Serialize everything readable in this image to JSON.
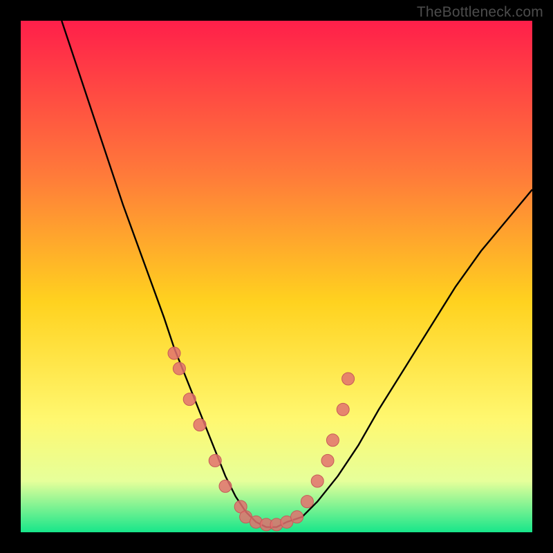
{
  "watermark": "TheBottleneck.com",
  "colors": {
    "frame": "#000000",
    "grad_top": "#ff1f4a",
    "grad_upper": "#ff7a3a",
    "grad_mid": "#ffd21f",
    "grad_lower": "#fff870",
    "grad_band": "#e6ff9a",
    "grad_bottom": "#17e68a",
    "curve": "#000000",
    "dot_fill": "#e2716f",
    "dot_stroke": "#c55a58"
  },
  "chart_data": {
    "type": "line",
    "title": "",
    "xlabel": "",
    "ylabel": "",
    "xlim": [
      0,
      100
    ],
    "ylim": [
      0,
      100
    ],
    "axes_visible": false,
    "grid": false,
    "legend": false,
    "series": [
      {
        "name": "bottleneck-curve",
        "x": [
          8,
          12,
          16,
          20,
          24,
          28,
          30,
          32,
          34,
          36,
          38,
          40,
          42,
          44,
          46,
          48,
          50,
          52,
          55,
          58,
          62,
          66,
          70,
          75,
          80,
          85,
          90,
          95,
          100
        ],
        "y": [
          100,
          88,
          76,
          64,
          53,
          42,
          36,
          31,
          26,
          21,
          16,
          11,
          7,
          4,
          2,
          1,
          1,
          2,
          3,
          6,
          11,
          17,
          24,
          32,
          40,
          48,
          55,
          61,
          67
        ]
      }
    ],
    "markers": [
      {
        "name": "left-cluster",
        "x": [
          30,
          31,
          33,
          35,
          38,
          40,
          43
        ],
        "y": [
          35,
          32,
          26,
          21,
          14,
          9,
          5
        ]
      },
      {
        "name": "valley-cluster",
        "x": [
          44,
          46,
          48,
          50,
          52,
          54
        ],
        "y": [
          3,
          2,
          1.5,
          1.5,
          2,
          3
        ]
      },
      {
        "name": "right-cluster",
        "x": [
          56,
          58,
          60,
          61,
          63,
          64
        ],
        "y": [
          6,
          10,
          14,
          18,
          24,
          30
        ]
      }
    ],
    "background_gradient_stops": [
      {
        "pos": 0.0,
        "color": "#ff1f4a"
      },
      {
        "pos": 0.3,
        "color": "#ff7a3a"
      },
      {
        "pos": 0.55,
        "color": "#ffd21f"
      },
      {
        "pos": 0.78,
        "color": "#fff870"
      },
      {
        "pos": 0.9,
        "color": "#e6ff9a"
      },
      {
        "pos": 1.0,
        "color": "#17e68a"
      }
    ]
  }
}
